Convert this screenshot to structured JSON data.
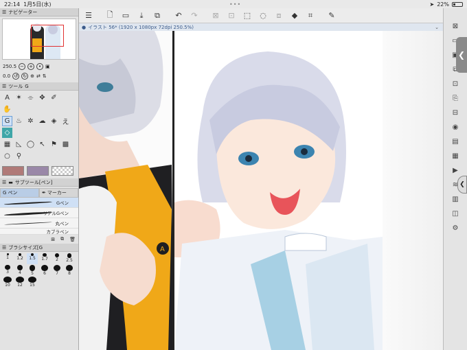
{
  "status_bar": {
    "time": "22:14",
    "date": "1月5日(水)",
    "battery": "22%"
  },
  "toolbar": {
    "icons": [
      "menu-icon",
      "new-file-icon",
      "open-folder-icon",
      "save-icon",
      "export-icon",
      "undo-icon",
      "redo-icon",
      "clear-icon",
      "transform-icon",
      "select-all-icon",
      "deselect-icon",
      "fill-icon",
      "crop-icon",
      "edit-icon"
    ]
  },
  "navigator": {
    "tab_label": "ナビゲーター",
    "zoom": "250.5",
    "rotation": "0.0"
  },
  "tool_panel": {
    "tab_label": "ツール",
    "tab_extra": "G"
  },
  "colors": {
    "main": "#b07a78",
    "sub": "#9a88a8"
  },
  "subtool": {
    "tab_label": "サブツール[ペン]",
    "tabs": [
      "ペン",
      "マーカー"
    ],
    "brushes": [
      "Gペン",
      "リアルGペン",
      "丸ペン",
      "カブラペン"
    ]
  },
  "brush_size": {
    "tab_label": "ブラシサイズ[G",
    "sizes": [
      "1",
      "1.2",
      "1.5",
      "1.7",
      "2",
      "2.5",
      "3",
      "4",
      "5",
      "6",
      "7",
      "8",
      "10",
      "12",
      "15"
    ]
  },
  "document": {
    "tab_title": "イラスト 56* (1920 x 1080px 72dpi 250.5%)"
  }
}
